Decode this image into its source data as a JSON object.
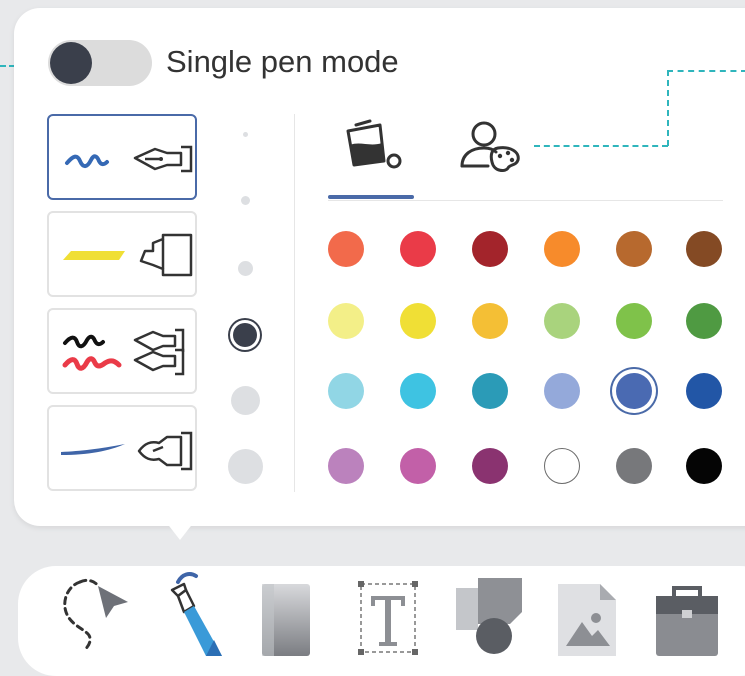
{
  "pen_panel": {
    "single_pen_mode": {
      "label": "Single pen mode",
      "enabled": false
    },
    "pen_types": [
      {
        "name": "fountain-pen",
        "selected": true
      },
      {
        "name": "highlighter",
        "selected": false
      },
      {
        "name": "multi-color-pen",
        "selected": false
      },
      {
        "name": "brush-pen",
        "selected": false
      }
    ],
    "sizes": [
      {
        "level": 1,
        "selected": false
      },
      {
        "level": 2,
        "selected": false
      },
      {
        "level": 3,
        "selected": false
      },
      {
        "level": 4,
        "selected": true
      },
      {
        "level": 5,
        "selected": false
      },
      {
        "level": 6,
        "selected": false
      }
    ],
    "color_tabs": [
      {
        "name": "color-fill-icon",
        "active": true
      },
      {
        "name": "user-palette-icon",
        "active": false
      }
    ],
    "colors": [
      [
        "#f26a4b",
        "#ea3b48",
        "#a3242b",
        "#f78b2b",
        "#b7692e",
        "#844a24"
      ],
      [
        "#f3ef88",
        "#f0df35",
        "#f4bf35",
        "#a9d37d",
        "#7fc24a",
        "#4f9a42"
      ],
      [
        "#91d6e5",
        "#3ec3e2",
        "#2b9bb7",
        "#94a9da",
        "#4a6ab2",
        "#2256a6"
      ],
      [
        "#bb82bd",
        "#c260a8",
        "#8a3370",
        "#ffffff",
        "#77787b",
        "#050505"
      ]
    ],
    "selected_color": "#4a6ab2"
  },
  "toolbar": {
    "tools": [
      "select-tool",
      "pen-tool",
      "eraser-tool",
      "text-tool",
      "shapes-tool",
      "image-tool",
      "toolbox-tool"
    ],
    "active_tool": "pen-tool"
  }
}
